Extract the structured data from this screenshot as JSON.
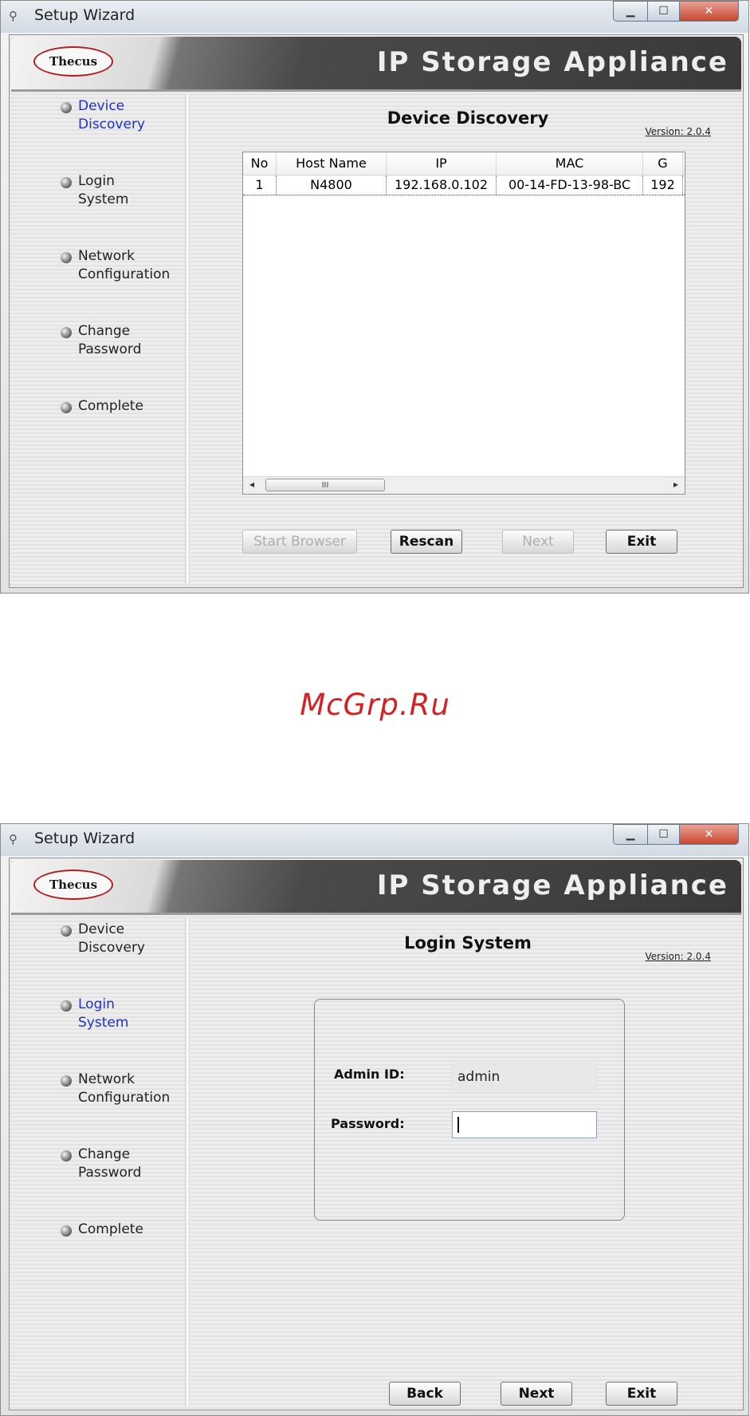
{
  "window": {
    "title": "Setup Wizard",
    "app_name": "IP Storage Appliance",
    "logo_text": "Thecus",
    "version": "Version: 2.0.4"
  },
  "steps": [
    {
      "line1": "Device",
      "line2": "Discovery"
    },
    {
      "line1": "Login",
      "line2": "System"
    },
    {
      "line1": "Network",
      "line2": "Configuration"
    },
    {
      "line1": "Change",
      "line2": "Password"
    },
    {
      "line1": "Complete",
      "line2": ""
    }
  ],
  "discovery": {
    "heading": "Device Discovery",
    "columns": [
      "No",
      "Host Name",
      "IP",
      "MAC",
      "G"
    ],
    "rows": [
      [
        "1",
        "N4800",
        "192.168.0.102",
        "00-14-FD-13-98-BC",
        "192"
      ]
    ],
    "scroll_thumb": "III",
    "buttons": {
      "start_browser": "Start Browser",
      "rescan": "Rescan",
      "next": "Next",
      "exit": "Exit"
    }
  },
  "login": {
    "heading": "Login System",
    "admin_label": "Admin ID:",
    "admin_value": "admin",
    "password_label": "Password:",
    "password_value": "",
    "buttons": {
      "back": "Back",
      "next": "Next",
      "exit": "Exit"
    }
  },
  "watermark": "McGrp.Ru",
  "colors": {
    "active_step": "#2030c8",
    "watermark": "#d82020",
    "close_button": "#c9472d"
  }
}
